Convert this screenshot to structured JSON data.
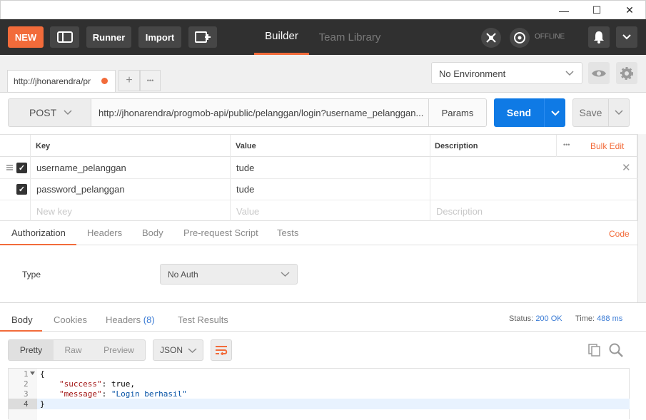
{
  "window": {
    "minimize": "—",
    "maximize": "☐",
    "close": "✕"
  },
  "header": {
    "new_label": "NEW",
    "runner_label": "Runner",
    "import_label": "Import",
    "tabs": [
      {
        "label": "Builder"
      },
      {
        "label": "Team Library"
      }
    ],
    "offline_label": "OFFLINE"
  },
  "request_tab": {
    "title": "http://jhonarendra/pr",
    "add": "+",
    "more": "•••"
  },
  "environment": {
    "selected": "No Environment"
  },
  "request": {
    "method": "POST",
    "url": "http://jhonarendra/progmob-api/public/pelanggan/login?username_pelanggan...",
    "params_label": "Params",
    "send_label": "Send",
    "save_label": "Save"
  },
  "params_table": {
    "headers": {
      "key": "Key",
      "value": "Value",
      "description": "Description"
    },
    "bulk_edit": "Bulk Edit",
    "more": "•••",
    "rows": [
      {
        "key": "username_pelanggan",
        "value": "tude",
        "description": ""
      },
      {
        "key": "password_pelanggan",
        "value": "tude",
        "description": ""
      }
    ],
    "placeholders": {
      "key": "New key",
      "value": "Value",
      "description": "Description"
    }
  },
  "request_tabs": [
    {
      "label": "Authorization"
    },
    {
      "label": "Headers"
    },
    {
      "label": "Body"
    },
    {
      "label": "Pre-request Script"
    },
    {
      "label": "Tests"
    }
  ],
  "code_link": "Code",
  "auth": {
    "type_label": "Type",
    "type_value": "No Auth"
  },
  "response": {
    "tabs": [
      {
        "label": "Body"
      },
      {
        "label": "Cookies"
      },
      {
        "label": "Headers"
      },
      {
        "label": "Test Results"
      }
    ],
    "headers_count": "(8)",
    "status_label": "Status:",
    "status_value": "200 OK",
    "time_label": "Time:",
    "time_value": "488 ms",
    "view_modes": [
      {
        "label": "Pretty"
      },
      {
        "label": "Raw"
      },
      {
        "label": "Preview"
      }
    ],
    "format": "JSON",
    "body_lines": [
      {
        "num": "1",
        "text": "{"
      },
      {
        "num": "2",
        "key": "\"success\"",
        "sep": ": ",
        "val": "true",
        "end": ","
      },
      {
        "num": "3",
        "key": "\"message\"",
        "sep": ": ",
        "val": "\"Login berhasil\"",
        "end": ""
      },
      {
        "num": "4",
        "text": "}"
      }
    ]
  },
  "colors": {
    "accent": "#f26b3a",
    "send_blue": "#0f7ae5",
    "header_bg": "#303030",
    "status_ok": "#3a7bd5"
  }
}
